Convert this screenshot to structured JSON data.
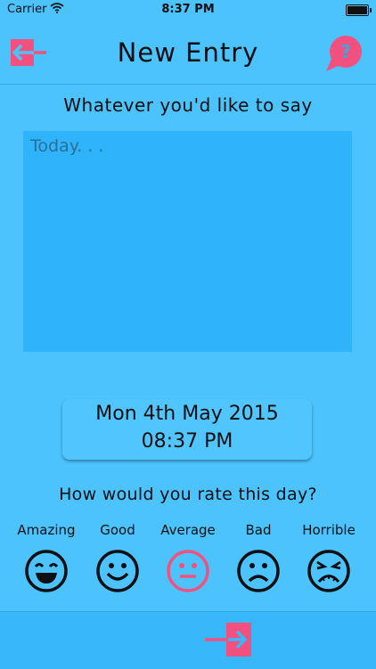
{
  "status": {
    "carrier": "Carrier",
    "time": "8:37 PM"
  },
  "header": {
    "title": "New Entry"
  },
  "help": {
    "glyph": "?"
  },
  "prompt": "Whatever you'd like to say",
  "entry": {
    "placeholder": "Today. . .",
    "value": ""
  },
  "datetime": {
    "date": "Mon 4th May 2015",
    "time": "08:37 PM"
  },
  "rating": {
    "question": "How would you rate this day?",
    "options": [
      {
        "label": "Amazing",
        "icon": "laughing-face-icon"
      },
      {
        "label": "Good",
        "icon": "smiling-face-icon"
      },
      {
        "label": "Average",
        "icon": "neutral-face-icon",
        "selected": true
      },
      {
        "label": "Bad",
        "icon": "frowning-face-icon"
      },
      {
        "label": "Horrible",
        "icon": "distressed-face-icon"
      }
    ]
  },
  "colors": {
    "background": "#4cc3fd",
    "accent": "#f2517f",
    "text": "#0d0f12",
    "text_area": "#2fb4fb"
  }
}
